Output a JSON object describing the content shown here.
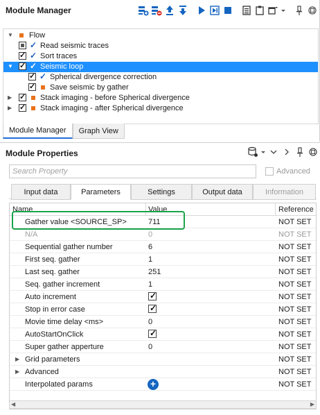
{
  "module_manager": {
    "title": "Module Manager",
    "toolbar_icons": [
      "add-module-icon",
      "remove-module-icon",
      "move-up-icon",
      "move-down-icon",
      "run-icon",
      "run-step-icon",
      "stop-icon",
      "properties-icon",
      "clipboard-icon",
      "window-menu-icon",
      "pin-icon",
      "float-icon"
    ],
    "tree": [
      {
        "label": "Flow",
        "level": 0,
        "checkbox": "none",
        "marker": "square"
      },
      {
        "label": "Read seismic traces",
        "level": 1,
        "checkbox": "filled",
        "marker": "tick"
      },
      {
        "label": "Sort traces",
        "level": 1,
        "checkbox": "checked",
        "marker": "tick"
      },
      {
        "label": "Seismic loop",
        "level": 1,
        "checkbox": "checked",
        "marker": "tick",
        "selected": true
      },
      {
        "label": "Spherical divergence correction",
        "level": 2,
        "checkbox": "checked",
        "marker": "tick"
      },
      {
        "label": "Save seismic by gather",
        "level": 2,
        "checkbox": "checked",
        "marker": "square"
      },
      {
        "label": "Stack imaging - before Spherical divergence",
        "level": 1,
        "checkbox": "checked",
        "marker": "square"
      },
      {
        "label": "Stack imaging - after Spherical divergence",
        "level": 1,
        "checkbox": "checked",
        "marker": "square"
      }
    ],
    "tabs": [
      "Module Manager",
      "Graph View"
    ],
    "active_tab": "Module Manager"
  },
  "module_properties": {
    "title": "Module Properties",
    "search_placeholder": "Search Property",
    "advanced_label": "Advanced",
    "tabs": [
      "Input data",
      "Parameters",
      "Settings",
      "Output data",
      "Information"
    ],
    "active_tab": "Parameters",
    "columns": {
      "name": "Name",
      "value": "Value",
      "reference": "Reference"
    },
    "rows": [
      {
        "name": "Gather value <SOURCE_SP>",
        "value": "711",
        "reference": "NOT SET"
      },
      {
        "name": "N/A",
        "value": "0",
        "reference": "NOT SET"
      },
      {
        "name": "Sequential gather number",
        "value": "6",
        "reference": "NOT SET"
      },
      {
        "name": "First seq. gather",
        "value": "1",
        "reference": "NOT SET"
      },
      {
        "name": "Last seq. gather",
        "value": "251",
        "reference": "NOT SET"
      },
      {
        "name": "Seq. gather increment",
        "value": "1",
        "reference": "NOT SET"
      },
      {
        "name": "Auto increment",
        "value": "",
        "reference": "NOT SET"
      },
      {
        "name": "Stop in error case",
        "value": "",
        "reference": "NOT SET"
      },
      {
        "name": "Movie time delay <ms>",
        "value": "0",
        "reference": "NOT SET"
      },
      {
        "name": "AutoStartOnClick",
        "value": "",
        "reference": "NOT SET"
      },
      {
        "name": "Super gather apperture",
        "value": "0",
        "reference": "NOT SET"
      },
      {
        "name": "Grid parameters",
        "value": "",
        "reference": "NOT SET"
      },
      {
        "name": "Advanced",
        "value": "",
        "reference": "NOT SET"
      },
      {
        "name": "Interpolated params",
        "value": "",
        "reference": "NOT SET"
      }
    ]
  },
  "colors": {
    "selection": "#1e90ff",
    "highlight_border": "#1aa34a",
    "module_marker": "#e8731c",
    "tick": "#1b5fc0"
  }
}
